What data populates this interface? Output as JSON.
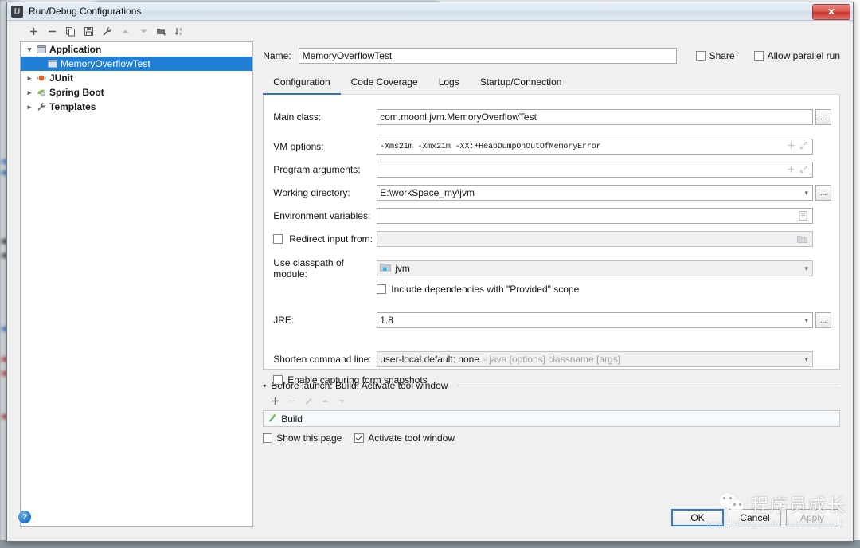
{
  "window": {
    "title": "Run/Debug Configurations",
    "app_icon": "IJ",
    "close_label": "✕"
  },
  "toolbar": {
    "buttons": [
      {
        "name": "add",
        "icon": "plus-icon",
        "glyph": "+",
        "enabled": true
      },
      {
        "name": "remove",
        "icon": "minus-icon",
        "glyph": "−",
        "enabled": true
      },
      {
        "name": "copy",
        "icon": "copy-icon",
        "glyph": "⧉",
        "enabled": true
      },
      {
        "name": "save",
        "icon": "save-icon",
        "glyph": "Ὃe",
        "enabled": true
      },
      {
        "name": "edit-templates",
        "icon": "wrench-icon",
        "glyph": "ὒ7",
        "enabled": true
      },
      {
        "name": "move-up",
        "icon": "arrow-up-icon",
        "glyph": "▲",
        "enabled": false
      },
      {
        "name": "move-down",
        "icon": "arrow-down-icon",
        "glyph": "▼",
        "enabled": false
      },
      {
        "name": "move-into-folder",
        "icon": "folder-add-icon",
        "glyph": "Ὄ1",
        "enabled": true
      },
      {
        "name": "sort-alphabetically",
        "icon": "sort-az-icon",
        "glyph": "↓",
        "enabled": true
      }
    ]
  },
  "tree": {
    "items": [
      {
        "label": "Application",
        "icon": "application-icon",
        "level": 0,
        "twisty": "expanded",
        "bold": true,
        "selected": false
      },
      {
        "label": "MemoryOverflowTest",
        "icon": "configuration-icon",
        "level": 1,
        "twisty": "none",
        "bold": false,
        "selected": true
      },
      {
        "label": "JUnit",
        "icon": "junit-icon",
        "level": 0,
        "twisty": "collapsed",
        "bold": true,
        "selected": false
      },
      {
        "label": "Spring Boot",
        "icon": "spring-icon",
        "level": 0,
        "twisty": "collapsed",
        "bold": true,
        "selected": false
      },
      {
        "label": "Templates",
        "icon": "wrench-icon",
        "level": 0,
        "twisty": "collapsed",
        "bold": true,
        "selected": false
      }
    ]
  },
  "header": {
    "name_label": "Name:",
    "name_value": "MemoryOverflowTest",
    "share_label": "Share",
    "share_checked": false,
    "parallel_label": "Allow parallel run",
    "parallel_checked": false
  },
  "tabs": [
    {
      "label": "Configuration",
      "active": true
    },
    {
      "label": "Code Coverage",
      "active": false
    },
    {
      "label": "Logs",
      "active": false
    },
    {
      "label": "Startup/Connection",
      "active": false
    }
  ],
  "form": {
    "main_class_label": "Main class:",
    "main_class_value": "com.moonl.jvm.MemoryOverflowTest",
    "vm_options_label": "VM options:",
    "vm_options_value": "-Xms21m -Xmx21m -XX:+HeapDumpOnOutOfMemoryError",
    "program_args_label": "Program arguments:",
    "program_args_value": "",
    "working_dir_label": "Working directory:",
    "working_dir_value": "E:\\workSpace_my\\jvm",
    "env_vars_label": "Environment variables:",
    "env_vars_value": "",
    "redirect_input_label": "Redirect input from:",
    "redirect_input_checked": false,
    "redirect_input_value": "",
    "classpath_label": "Use classpath of module:",
    "classpath_value": "jvm",
    "include_provided_label": "Include dependencies with \"Provided\" scope",
    "include_provided_checked": false,
    "jre_label": "JRE:",
    "jre_value": "1.8",
    "shorten_label": "Shorten command line:",
    "shorten_value": "user-local default: none",
    "shorten_hint": "- java [options] classname [args]",
    "snapshots_label": "Enable capturing form snapshots",
    "snapshots_checked": false,
    "browse_label": "...",
    "add_macro_icon": "plus-icon",
    "expand_icon": "expand-icon",
    "env_list_icon": "list-icon",
    "folder_icon": "folder-icon",
    "dropdown_icon": "chevron-down-icon"
  },
  "before_launch": {
    "title": "Before launch: Build, Activate tool window",
    "toolbar": [
      {
        "name": "add-task",
        "icon": "plus-icon",
        "glyph": "+",
        "enabled": true
      },
      {
        "name": "remove-task",
        "icon": "minus-icon",
        "glyph": "−",
        "enabled": false
      },
      {
        "name": "edit-task",
        "icon": "pencil-icon",
        "glyph": "✎",
        "enabled": false
      },
      {
        "name": "move-task-up",
        "icon": "arrow-up-icon",
        "glyph": "▲",
        "enabled": false
      },
      {
        "name": "move-task-down",
        "icon": "arrow-down-icon",
        "glyph": "▼",
        "enabled": false
      }
    ],
    "tasks": [
      {
        "label": "Build",
        "icon": "hammer-icon"
      }
    ],
    "show_page_label": "Show this page",
    "show_page_checked": false,
    "activate_tool_window_label": "Activate tool window",
    "activate_tool_window_checked": true
  },
  "footer": {
    "help_label": "?",
    "ok_label": "OK",
    "cancel_label": "Cancel",
    "apply_label": "Apply",
    "apply_enabled": false
  },
  "watermark": {
    "text": "程序员成长",
    "icon": "wechat-icon",
    "url": "https://blog.csdn.net/liaoyuec1"
  },
  "colors": {
    "accent": "#2d76c9",
    "selection": "#1e7fd4",
    "title_bg": "#dce7f1",
    "dialog_bg": "#f0f0f0",
    "close_red": "#c8322a"
  }
}
